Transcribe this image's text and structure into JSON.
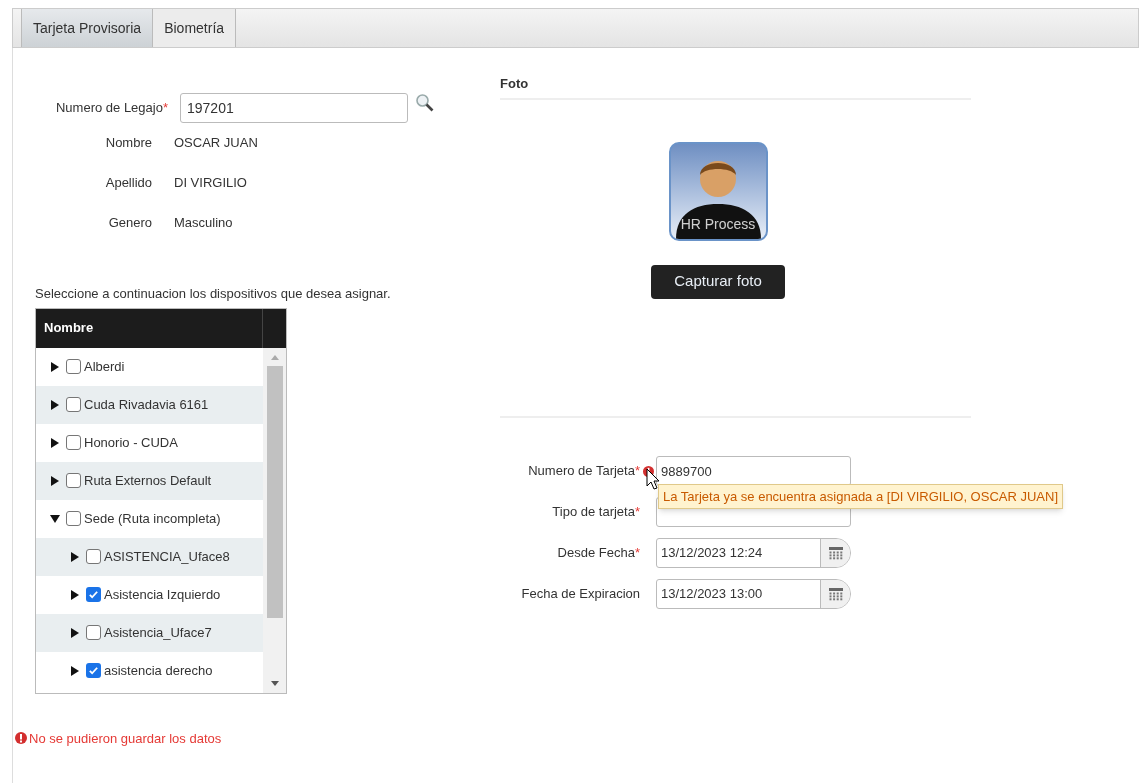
{
  "tabs": [
    {
      "label": "Tarjeta Provisoria",
      "selected": true
    },
    {
      "label": "Biometría",
      "selected": false
    }
  ],
  "employee": {
    "legajo_label": "Numero de Legajo",
    "legajo_required_mark": "*",
    "legajo_value": "197201",
    "fields": [
      {
        "label": "Nombre",
        "value": "OSCAR JUAN"
      },
      {
        "label": "Apellido",
        "value": "DI VIRGILIO"
      },
      {
        "label": "Genero",
        "value": "Masculino"
      }
    ]
  },
  "devices": {
    "instruction": "Seleccione a continuacion los dispositivos que desea asignar.",
    "column": "Nombre",
    "items": [
      {
        "label": "Alberdi",
        "checked": false,
        "expanded": false
      },
      {
        "label": "Cuda Rivadavia 6161",
        "checked": false,
        "expanded": false
      },
      {
        "label": "Honorio - CUDA",
        "checked": false,
        "expanded": false
      },
      {
        "label": "Ruta Externos Default",
        "checked": false,
        "expanded": false
      },
      {
        "label": "Sede (Ruta incompleta)",
        "checked": false,
        "expanded": true,
        "children": [
          {
            "label": "ASISTENCIA_Uface8",
            "checked": false,
            "expanded": false
          },
          {
            "label": "Asistencia Izquierdo",
            "checked": true,
            "expanded": false
          },
          {
            "label": "Asistencia_Uface7",
            "checked": false,
            "expanded": false
          },
          {
            "label": "asistencia derecho",
            "checked": true,
            "expanded": false
          }
        ]
      }
    ]
  },
  "error_message": "No se pudieron guardar los datos",
  "photo": {
    "title": "Foto",
    "avatar_caption": "HR Process",
    "capture_button": "Capturar foto"
  },
  "card": {
    "fields": [
      {
        "kind": "text",
        "label": "Numero de Tarjeta",
        "required_mark": "*",
        "error": true,
        "value": "9889700"
      },
      {
        "kind": "text",
        "label": "Tipo de tarjeta",
        "required_mark": "*",
        "error": false
      },
      {
        "kind": "date",
        "label": "Desde Fecha",
        "required_mark": "*",
        "error": false,
        "value": "13/12/2023 12:24"
      },
      {
        "kind": "date",
        "label": "Fecha de Expiracion",
        "error": false,
        "value": "13/12/2023 13:00"
      }
    ],
    "tooltip": "La Tarjeta ya se encuentra asignada a [DI VIRGILIO, OSCAR JUAN]"
  }
}
